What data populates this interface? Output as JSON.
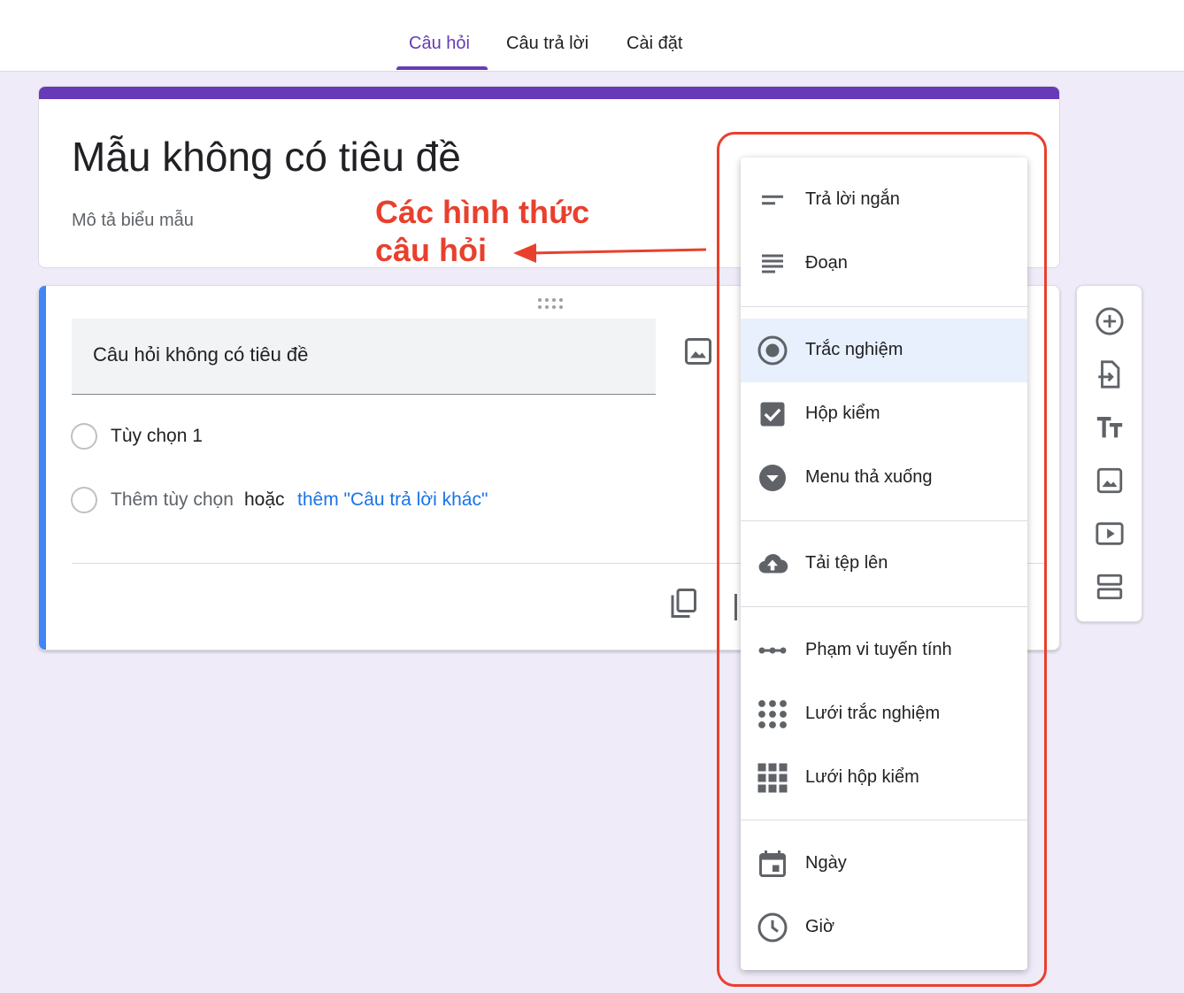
{
  "tabs": [
    {
      "label": "Câu hỏi",
      "active": true
    },
    {
      "label": "Câu trả lời",
      "active": false
    },
    {
      "label": "Cài đặt",
      "active": false
    }
  ],
  "form": {
    "title": "Mẫu không có tiêu đề",
    "description": "Mô tả biểu mẫu"
  },
  "annotation": {
    "line1": "Các hình thức",
    "line2": "câu hỏi"
  },
  "question": {
    "title": "Câu hỏi không có tiêu đề",
    "option1": "Tùy chọn 1",
    "add_option": "Thêm tùy chọn",
    "or": "hoặc",
    "add_other": "thêm \"Câu trả lời khác\""
  },
  "question_types": [
    {
      "label": "Trả lời ngắn",
      "icon": "short-answer-icon"
    },
    {
      "label": "Đoạn",
      "icon": "paragraph-icon"
    },
    {
      "label": "Trắc nghiệm",
      "icon": "radio-icon",
      "selected": true
    },
    {
      "label": "Hộp kiểm",
      "icon": "checkbox-icon"
    },
    {
      "label": "Menu thả xuống",
      "icon": "dropdown-icon"
    },
    {
      "label": "Tải tệp lên",
      "icon": "cloud-upload-icon"
    },
    {
      "label": "Phạm vi tuyến tính",
      "icon": "linear-scale-icon"
    },
    {
      "label": "Lưới trắc nghiệm",
      "icon": "radio-grid-icon"
    },
    {
      "label": "Lưới hộp kiểm",
      "icon": "checkbox-grid-icon"
    },
    {
      "label": "Ngày",
      "icon": "calendar-icon"
    },
    {
      "label": "Giờ",
      "icon": "clock-icon"
    }
  ],
  "side_tools": [
    "add-question-icon",
    "import-questions-icon",
    "add-title-icon",
    "add-image-icon",
    "add-video-icon",
    "add-section-icon"
  ],
  "colors": {
    "accent": "#673ab7",
    "annotation": "#e8402d",
    "question_bar": "#4285f4",
    "link": "#1a73e8",
    "icon": "#5f6368"
  }
}
